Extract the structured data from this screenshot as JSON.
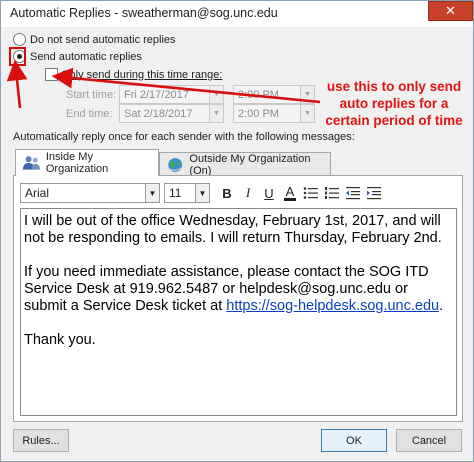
{
  "window": {
    "title": "Automatic Replies - sweatherman@sog.unc.edu",
    "close_glyph": "✕"
  },
  "options": {
    "do_not_send": "Do not send automatic replies",
    "send": "Send automatic replies",
    "only_send_range": "Only send during this time range:",
    "start_time_label": "Start time:",
    "end_time_label": "End time:",
    "start_date": "Fri 2/17/2017",
    "start_time": "2:00 PM",
    "end_date": "Sat 2/18/2017",
    "end_time": "2:00 PM"
  },
  "annotation": {
    "text": "use this to only send auto replies for a certain period of time",
    "color": "#e01414"
  },
  "section_label": "Automatically reply once for each sender with the following messages:",
  "tabs": [
    {
      "label": "Inside My Organization",
      "icon": "people-icon",
      "active": true
    },
    {
      "label": "Outside My Organization (On)",
      "icon": "globe-icon",
      "active": false
    }
  ],
  "toolbar": {
    "font": "Arial",
    "size": "11",
    "bold": "B",
    "italic": "I",
    "underline": "U",
    "font_color": "A"
  },
  "message": {
    "p1": "I will be out of the office Wednesday, February 1st, 2017, and will not be responding to emails. I will return Thursday, February 2nd.",
    "p2_text": "If you need immediate assistance, please contact the SOG ITD Service Desk at 919.962.5487 or helpdesk@sog.unc.edu or submit a Service Desk ticket at ",
    "p2_link": "https://sog-helpdesk.sog.unc.edu",
    "p2_end": ".",
    "p3": "Thank you."
  },
  "buttons": {
    "rules": "Rules...",
    "ok": "OK",
    "cancel": "Cancel"
  }
}
